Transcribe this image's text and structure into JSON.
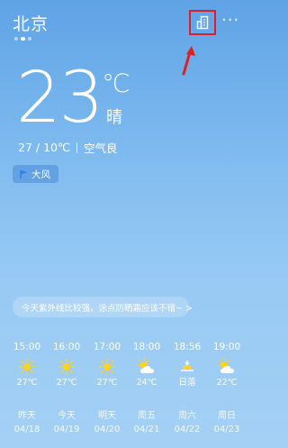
{
  "header": {
    "city": "北京",
    "page_dots": 3,
    "active_dot": 1
  },
  "current": {
    "temperature": "23",
    "unit": "℃",
    "condition": "晴",
    "high_low": "27 / 10℃",
    "air_quality": "空气良"
  },
  "alert": {
    "label": "大风",
    "icon": "flag-icon"
  },
  "tip": {
    "text": "今天紫外线比较强，涂点防晒霜应该不错~ >"
  },
  "hourly": [
    {
      "time": "15:00",
      "icon": "sun-icon",
      "value": "27℃"
    },
    {
      "time": "16:00",
      "icon": "sun-icon",
      "value": "27℃"
    },
    {
      "time": "17:00",
      "icon": "sun-icon",
      "value": "27℃"
    },
    {
      "time": "18:00",
      "icon": "partly-cloudy-icon",
      "value": "24℃"
    },
    {
      "time": "18:56",
      "icon": "sunset-icon",
      "value": "日落"
    },
    {
      "time": "19:00",
      "icon": "partly-cloudy-icon",
      "value": "22℃"
    }
  ],
  "daily": [
    {
      "day": "昨天",
      "date": "04/18"
    },
    {
      "day": "今天",
      "date": "04/19"
    },
    {
      "day": "明天",
      "date": "04/20"
    },
    {
      "day": "周五",
      "date": "04/21"
    },
    {
      "day": "周六",
      "date": "04/22"
    },
    {
      "day": "周日",
      "date": "04/23"
    }
  ],
  "colors": {
    "highlight_box": "#e02020",
    "arrow": "#e02020"
  }
}
